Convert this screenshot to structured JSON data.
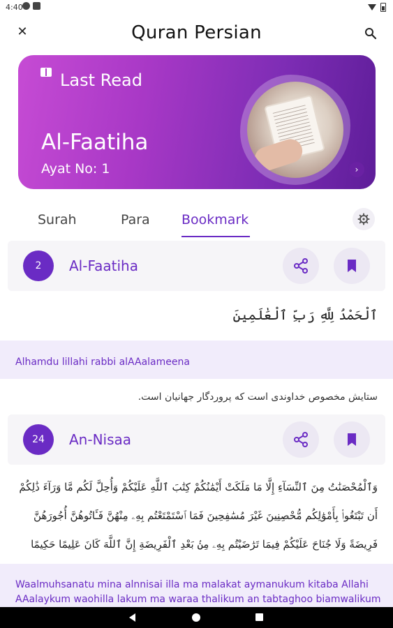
{
  "status_bar": {
    "time": "4:40"
  },
  "app_bar": {
    "title": "Quran Persian"
  },
  "last_read": {
    "label": "Last Read",
    "surah": "Al-Faatiha",
    "ayat": "Ayat No: 1"
  },
  "tabs": [
    {
      "label": "Surah",
      "active": false
    },
    {
      "label": "Para",
      "active": false
    },
    {
      "label": "Bookmark",
      "active": true
    }
  ],
  "bookmarks": [
    {
      "number": "2",
      "name": "Al-Faatiha",
      "arabic": "ٱلْحَمْدُ لِلَّهِ رَبِّ ٱلْعَٰلَمِينَ",
      "transliteration": "Alhamdu lillahi rabbi alAAalameena",
      "translation": "ستایش مخصوص خداوندی است که پروردگار جهانیان است."
    },
    {
      "number": "24",
      "name": "An-Nisaa",
      "arabic_lines": [
        "وَٱلْمُحْصَنَٰتُ مِنَ ٱلنِّسَآءِ إِلَّا مَا مَلَكَتْ أَيْمَٰنُكُمْ كِتَٰبَ ٱللَّهِ عَلَيْكُمْ وَأُحِلَّ لَكُم مَّا وَرَآءَ ذَٰلِكُمْ",
        "أَن تَبْتَغُوا۟ بِأَمْوَٰلِكُم مُّحْصِنِينَ غَيْرَ مُسَٰفِحِينَ فَمَا ٱسْتَمْتَعْتُم بِهِۦ مِنْهُنَّ فَـَٔاتُوهُنَّ أُجُورَهُنَّ",
        "فَرِيضَةً وَلَا جُنَاحَ عَلَيْكُمْ فِيمَا تَرَٰضَيْتُم بِهِۦ مِنۢ بَعْدِ ٱلْفَرِيضَةِ إِنَّ ٱللَّهَ كَانَ عَلِيمًا حَكِيمًا"
      ],
      "transliteration_lines": [
        "Waalmuhsanatu mina alnnisai illa ma malakat aymanukum kitaba Allahi",
        "AAalaykum waohilla lakum ma waraa thalikum an tabtaghoo biamwalikum"
      ]
    }
  ],
  "icons": [
    "close-icon",
    "search-icon",
    "book-icon",
    "chevron-right-icon",
    "gear-icon",
    "share-icon",
    "bookmark-icon"
  ],
  "colors": {
    "accent": "#6a2bc4",
    "card_start": "#c64bd4",
    "card_end": "#5e1d99"
  }
}
